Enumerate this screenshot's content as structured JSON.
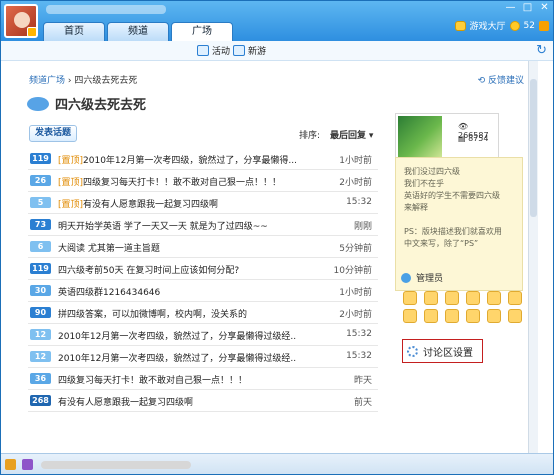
{
  "window": {
    "tabs": [
      "首页",
      "频道",
      "广场"
    ],
    "active_tab": 2,
    "right_info": {
      "game_hall": "游戏大厅",
      "coins": "52"
    },
    "controls": [
      "—",
      "□",
      "✕"
    ]
  },
  "subbar": {
    "activity": "活动",
    "new_game": "新游"
  },
  "breadcrumb": {
    "root": "频道广场",
    "sep": "›",
    "current": "四六级去死去死"
  },
  "feedback": "反馈建议",
  "page_title": "四六级去死去死",
  "post_button": "发表话题",
  "sort": {
    "label": "排序:",
    "value": "最后回复"
  },
  "posts": [
    {
      "num": "119",
      "color": "#2b7fd2",
      "tag": "[置顶]",
      "title": "2010年12月第一次考四级，貌然过了，分享最懒得...",
      "time": "1小时前"
    },
    {
      "num": "26",
      "color": "#5aa7e6",
      "tag": "[置顶]",
      "title": "四级复习每天打卡！！敢不敢对自己狠一点！！！",
      "time": "2小时前"
    },
    {
      "num": "5",
      "color": "#7fc0f0",
      "tag": "[置顶]",
      "title": "有没有人愿意跟我一起复习四级啊",
      "time": "15:32"
    },
    {
      "num": "73",
      "color": "#2b7fd2",
      "tag": "",
      "title": "明天开始学英语 学了一天又一天 就是为了过四级~~",
      "time": "刚刚"
    },
    {
      "num": "6",
      "color": "#7fc0f0",
      "tag": "",
      "title": "大阅读 尤其第一道主旨题",
      "time": "5分钟前"
    },
    {
      "num": "119",
      "color": "#2b7fd2",
      "tag": "",
      "title": "四六级考前50天 在复习时间上应该如何分配?",
      "time": "10分钟前"
    },
    {
      "num": "30",
      "color": "#5aa7e6",
      "tag": "",
      "title": "英语四级群1216434646",
      "time": "1小时前"
    },
    {
      "num": "90",
      "color": "#2b7fd2",
      "tag": "",
      "title": "拼四级答案，可以加微博啊，校内啊，没关系的",
      "time": "2小时前"
    },
    {
      "num": "12",
      "color": "#7fc0f0",
      "tag": "",
      "title": "2010年12月第一次考四级，貌然过了，分享最懒得过级经...",
      "time": "15:32"
    },
    {
      "num": "12",
      "color": "#7fc0f0",
      "tag": "",
      "title": "2010年12月第一次考四级，貌然过了，分享最懒得过级经...",
      "time": "15:32"
    },
    {
      "num": "36",
      "color": "#5aa7e6",
      "tag": "",
      "title": "四级复习每天打卡！敢不敢对自己狠一点！！！",
      "time": "昨天"
    },
    {
      "num": "268",
      "color": "#1f66b0",
      "tag": "",
      "title": "有没有人愿意跟我一起复习四级啊",
      "time": "前天"
    }
  ],
  "channel": {
    "members": "266587",
    "posts": "8754"
  },
  "description": [
    "我们没过四六级",
    "我们不在乎",
    "英语好的学生不需要四六级",
    "来解释",
    "",
    "PS：版块描述我们就喜欢用",
    "中文来写，除了“PS”"
  ],
  "admins_label": "管理员",
  "admin_count": 12,
  "settings_label": "讨论区设置"
}
